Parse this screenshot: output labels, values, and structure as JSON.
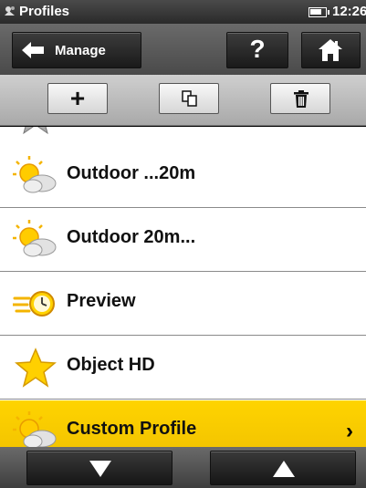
{
  "status_bar": {
    "app_title": "Profiles",
    "time": "12:26",
    "app_icon": "profiles-icon",
    "battery_icon": "battery-icon"
  },
  "toolbar": {
    "back_label": "Manage",
    "back_icon": "arrow-left-icon",
    "help_label": "?",
    "home_icon": "home-icon"
  },
  "actions": {
    "add_label": "+",
    "copy_icon": "copy-icon",
    "delete_icon": "trash-icon"
  },
  "profiles": [
    {
      "label": "",
      "icon": "star-icon",
      "partial": true
    },
    {
      "label": "Outdoor ...20m",
      "icon": "sun-cloud-icon"
    },
    {
      "label": "Outdoor 20m...",
      "icon": "sun-cloud-icon"
    },
    {
      "label": "Preview",
      "icon": "fast-clock-icon"
    },
    {
      "label": "Object HD",
      "icon": "star-icon"
    },
    {
      "label": "Custom Profile",
      "icon": "sun-cloud-icon",
      "selected": true,
      "chevron": "›"
    }
  ],
  "nav": {
    "down_icon": "arrow-down-icon",
    "up_icon": "arrow-up-icon"
  },
  "colors": {
    "selected_row": "#ffd400",
    "toolbar": "#555555",
    "action_bar": "#bdbdbd"
  }
}
